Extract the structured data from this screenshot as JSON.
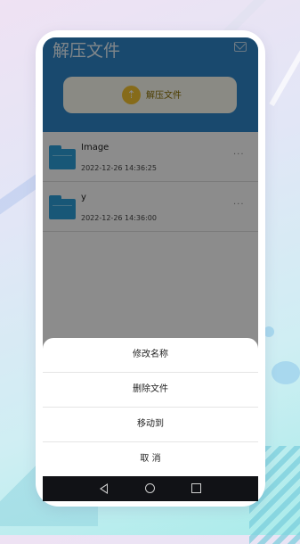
{
  "app": {
    "title": "解压文件"
  },
  "extract_button": {
    "icon": "zip-archive-icon",
    "label": "解压文件"
  },
  "files": [
    {
      "name": "Image",
      "date": "2022-12-26 14:36:25"
    },
    {
      "name": "y",
      "date": "2022-12-26 14:36:00"
    }
  ],
  "action_sheet": {
    "items": [
      {
        "label": "修改名称"
      },
      {
        "label": "删除文件"
      },
      {
        "label": "移动到"
      },
      {
        "label": "取 消"
      }
    ]
  },
  "more_glyph": "···",
  "colors": {
    "header": "#2f86c8",
    "folder": "#2c9fd9",
    "extract_icon": "#f4c430",
    "nav_bar": "#111216"
  }
}
